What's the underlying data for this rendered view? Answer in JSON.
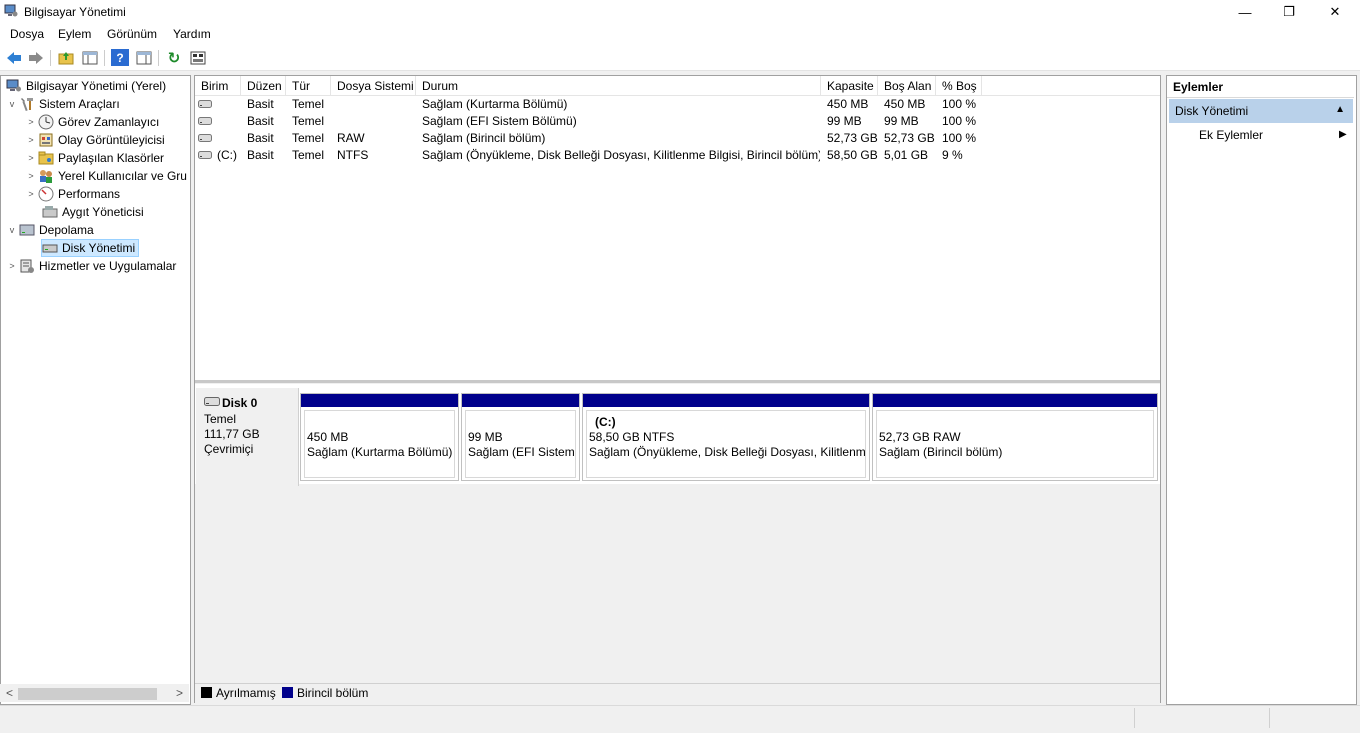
{
  "window": {
    "title": "Bilgisayar Yönetimi",
    "minimize_glyph": "—",
    "maximize_glyph": "❐",
    "close_glyph": "✕"
  },
  "menu": [
    "Dosya",
    "Eylem",
    "Görünüm",
    "Yardım"
  ],
  "toolbar": {
    "icons": [
      "back-arrow-icon",
      "forward-arrow-icon",
      "up-folder-icon",
      "show-hide-tree-icon",
      "help-icon",
      "show-hide-action-pane-icon",
      "refresh-icon",
      "properties-icon"
    ],
    "help_glyph": "?",
    "refresh_glyph": "↻"
  },
  "tree": {
    "root": "Bilgisayar Yönetimi (Yerel)",
    "system_tools": "Sistem Araçları",
    "task_scheduler": "Görev Zamanlayıcı",
    "event_viewer": "Olay Görüntüleyicisi",
    "shared_folders": "Paylaşılan Klasörler",
    "local_users": "Yerel Kullanıcılar ve Gru",
    "performance": "Performans",
    "device_manager": "Aygıt Yöneticisi",
    "storage": "Depolama",
    "disk_management": "Disk Yönetimi",
    "services": "Hizmetler ve Uygulamalar",
    "expanded_glyph": "v",
    "collapsed_glyph": ">",
    "scroll_left_glyph": "<",
    "scroll_right_glyph": ">"
  },
  "volume_table": {
    "columns": [
      "Birim",
      "Düzen",
      "Tür",
      "Dosya Sistemi",
      "Durum",
      "Kapasite",
      "Boş Alan",
      "% Boş"
    ],
    "rows": [
      {
        "volume": "",
        "layout": "Basit",
        "type": "Temel",
        "fs": "",
        "status": "Sağlam (Kurtarma Bölümü)",
        "capacity": "450 MB",
        "free": "450 MB",
        "pct": "100 %"
      },
      {
        "volume": "",
        "layout": "Basit",
        "type": "Temel",
        "fs": "",
        "status": "Sağlam (EFI Sistem Bölümü)",
        "capacity": "99 MB",
        "free": "99 MB",
        "pct": "100 %"
      },
      {
        "volume": "",
        "layout": "Basit",
        "type": "Temel",
        "fs": "RAW",
        "status": "Sağlam (Birincil bölüm)",
        "capacity": "52,73 GB",
        "free": "52,73 GB",
        "pct": "100 %"
      },
      {
        "volume": "(C:)",
        "layout": "Basit",
        "type": "Temel",
        "fs": "NTFS",
        "status": "Sağlam (Önyükleme, Disk Belleği Dosyası, Kilitlenme Bilgisi, Birincil bölüm)",
        "capacity": "58,50 GB",
        "free": "5,01 GB",
        "pct": "9 %"
      }
    ]
  },
  "disk": {
    "name": "Disk 0",
    "type": "Temel",
    "size": "111,77 GB",
    "state": "Çevrimiçi",
    "partitions": [
      {
        "label": "",
        "size": "450 MB",
        "status": "Sağlam (Kurtarma Bölümü)"
      },
      {
        "label": "",
        "size": "99 MB",
        "status": "Sağlam (EFI Sistem Bölümü)"
      },
      {
        "label": "(C:)",
        "size": "58,50 GB NTFS",
        "status": "Sağlam (Önyükleme, Disk Belleği Dosyası, Kilitlenme Bilgisi, Birincil bölüm)"
      },
      {
        "label": "",
        "size": "52,73 GB RAW",
        "status": "Sağlam (Birincil bölüm)"
      }
    ]
  },
  "legend": {
    "unallocated": "Ayrılmamış",
    "primary": "Birincil bölüm",
    "unallocated_color": "#000000",
    "primary_color": "#00008b"
  },
  "actions": {
    "title": "Eylemler",
    "section": "Disk Yönetimi",
    "section_glyph": "▲",
    "more": "Ek Eylemler",
    "more_glyph": "▶"
  }
}
